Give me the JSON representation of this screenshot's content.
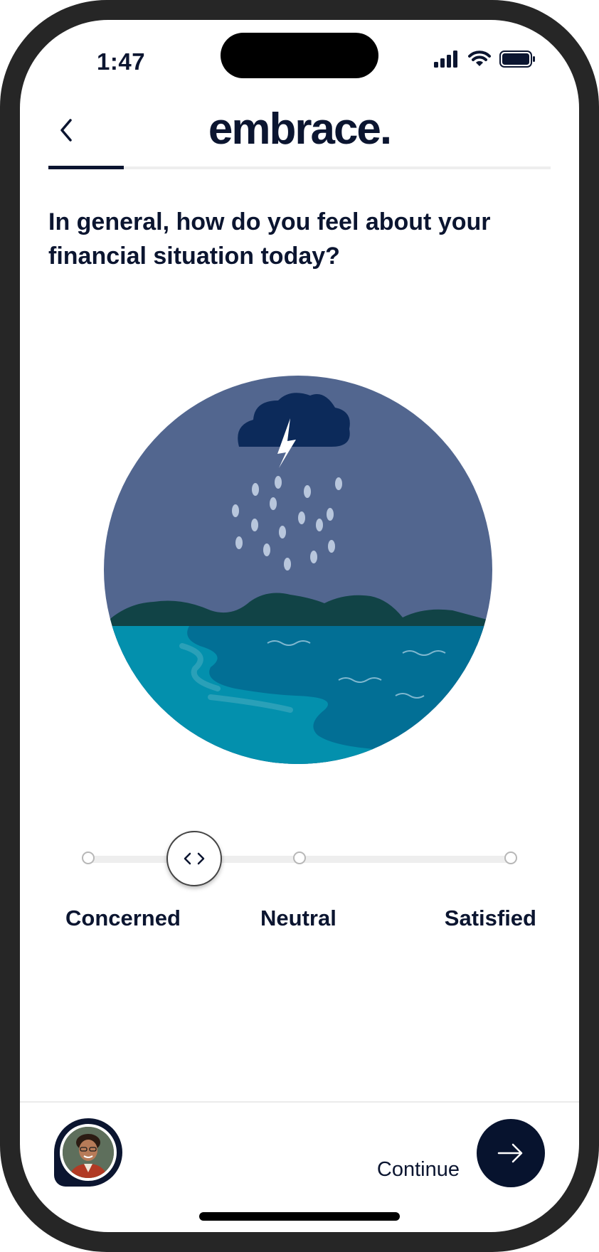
{
  "status_bar": {
    "time": "1:47",
    "icons": [
      "signal-icon",
      "wifi-icon",
      "battery-icon"
    ]
  },
  "header": {
    "logo_text": "embrace.",
    "back_icon": "chevron-left-icon"
  },
  "progress": {
    "value": 0.15
  },
  "question": {
    "text": "In general, how do you feel about your financial situation today?"
  },
  "illustration": {
    "subject": "storm-cloud-over-sea",
    "colors": {
      "sky": "#52668f",
      "cloud": "#0c2a5a",
      "rain": "#b8c6dc",
      "hills": "#114346",
      "sea_light": "#0390ad",
      "sea_dark": "#026f95"
    }
  },
  "slider": {
    "stops": 3,
    "selected_position": 0.25,
    "thumb_icon": "chevron-left-right-icon",
    "labels": [
      "Concerned",
      "Neutral",
      "Satisfied"
    ]
  },
  "footer": {
    "avatar": "advisor-avatar",
    "continue_label": "Continue",
    "continue_icon": "arrow-right-icon"
  },
  "colors": {
    "primary": "#0b1530",
    "track": "#eeeeee"
  }
}
